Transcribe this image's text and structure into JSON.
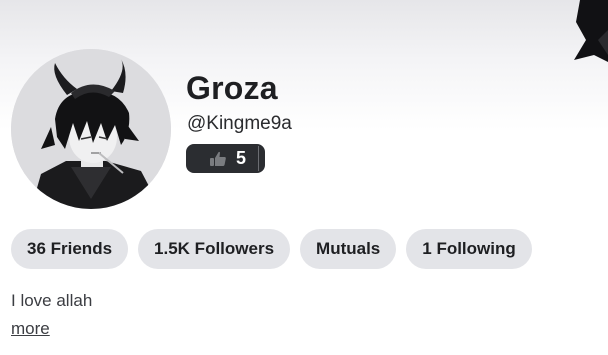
{
  "profile": {
    "display_name": "Groza",
    "username": "@Kingme9a",
    "likes_count": "5",
    "bio": "I love allah",
    "more_label": "more"
  },
  "stats": [
    {
      "label": "36 Friends"
    },
    {
      "label": "1.5K Followers"
    },
    {
      "label": "Mutuals"
    },
    {
      "label": "1 Following"
    }
  ],
  "icons": {
    "likes": "thumbs-up-icon",
    "avatar": "avatar-image"
  },
  "colors": {
    "badge_bg": "#2b2d31",
    "pill_bg": "#e3e4e8",
    "text_primary": "#1e1f22",
    "text_secondary": "#3b3d42"
  }
}
